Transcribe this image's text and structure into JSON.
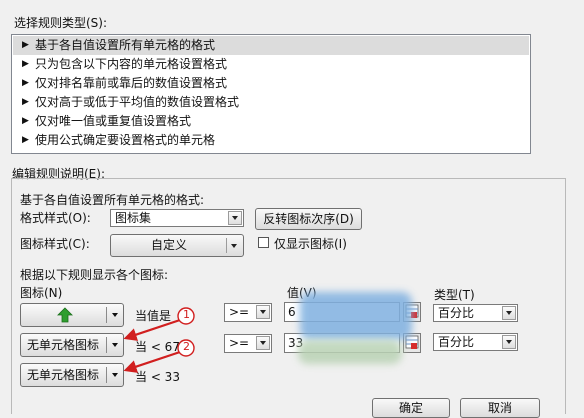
{
  "rule_type": {
    "label": "选择规则类型(S):",
    "items": [
      "基于各自值设置所有单元格的格式",
      "只为包含以下内容的单元格设置格式",
      "仅对排名靠前或靠后的数值设置格式",
      "仅对高于或低于平均值的数值设置格式",
      "仅对唯一值或重复值设置格式",
      "使用公式确定要设置格式的单元格"
    ],
    "selected_index": 0
  },
  "edit": {
    "label": "编辑规则说明(E):",
    "description": "基于各自值设置所有单元格的格式:",
    "format_style_label": "格式样式(O):",
    "format_style_value": "图标集",
    "reverse_order_button": "反转图标次序(D)",
    "icon_style_label": "图标样式(C):",
    "icon_style_value": "自定义",
    "show_icon_only_label": "仅显示图标(I)",
    "show_icon_only_checked": false,
    "rules_caption": "根据以下规则显示各个图标:",
    "col_icon": "图标(N)",
    "col_value": "值(V)",
    "col_type": "类型(T)",
    "rows": [
      {
        "icon_label": "",
        "icon": "green-up-arrow",
        "condition_text": "当值是",
        "operator": ">=",
        "value": "6",
        "type": "百分比"
      },
      {
        "icon_label": "无单元格图标",
        "condition_text": "当 < 67",
        "operator": ">=",
        "value": "33",
        "type": "百分比"
      },
      {
        "icon_label": "无单元格图标",
        "condition_text": "当 < 33"
      }
    ]
  },
  "annotations": [
    "1",
    "2"
  ],
  "footer": {
    "ok": "确定",
    "cancel": "取消"
  },
  "colors": {
    "green_arrow": "#2e9e2e",
    "annotation_red": "#d11f1f",
    "blur_blue": "#7fb0e0",
    "blur_green": "#b9d2b4"
  }
}
